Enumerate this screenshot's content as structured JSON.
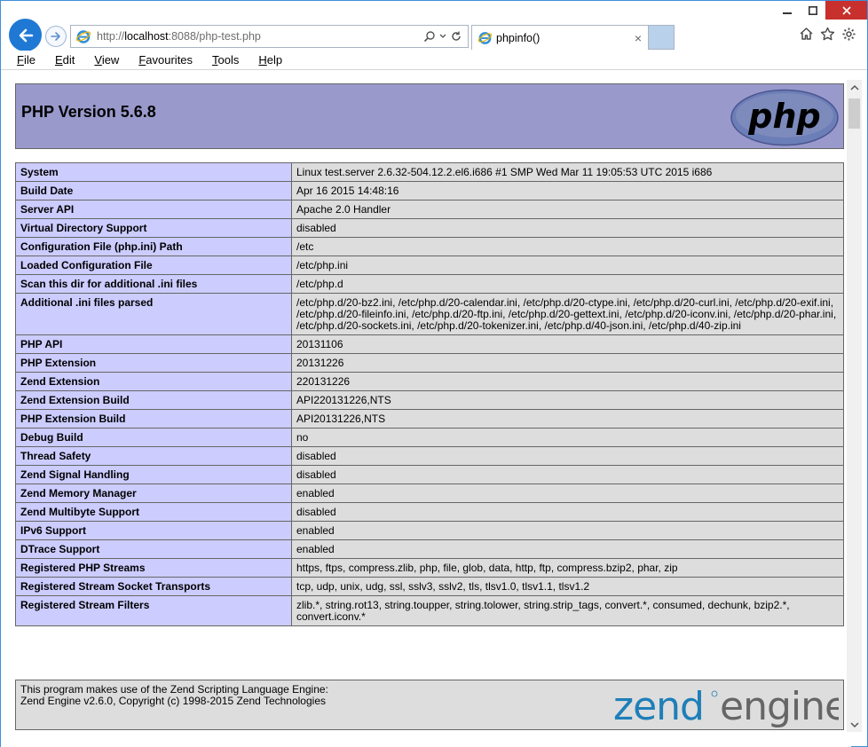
{
  "browser": {
    "address": {
      "proto": "http://",
      "host": "localhost",
      "rest": ":8088/php-test.php"
    },
    "tab_title": "phpinfo()",
    "menu": [
      {
        "label": "File",
        "key": "F",
        "rest": "ile"
      },
      {
        "label": "Edit",
        "key": "E",
        "rest": "dit"
      },
      {
        "label": "View",
        "key": "V",
        "rest": "iew"
      },
      {
        "label": "Favourites",
        "key": "F",
        "rest": "avourites"
      },
      {
        "label": "Tools",
        "key": "T",
        "rest": "ools"
      },
      {
        "label": "Help",
        "key": "H",
        "rest": "elp"
      }
    ],
    "accent_color": "#1f79d4",
    "close_color": "#c7302c"
  },
  "page": {
    "title": "PHP Version 5.6.8",
    "logo_text": "php",
    "rows": [
      {
        "key": "System",
        "value": "Linux test.server 2.6.32-504.12.2.el6.i686 #1 SMP Wed Mar 11 19:05:53 UTC 2015 i686"
      },
      {
        "key": "Build Date",
        "value": "Apr 16 2015 14:48:16"
      },
      {
        "key": "Server API",
        "value": "Apache 2.0 Handler"
      },
      {
        "key": "Virtual Directory Support",
        "value": "disabled"
      },
      {
        "key": "Configuration File (php.ini) Path",
        "value": "/etc"
      },
      {
        "key": "Loaded Configuration File",
        "value": "/etc/php.ini"
      },
      {
        "key": "Scan this dir for additional .ini files",
        "value": "/etc/php.d"
      },
      {
        "key": "Additional .ini files parsed",
        "value": "/etc/php.d/20-bz2.ini, /etc/php.d/20-calendar.ini, /etc/php.d/20-ctype.ini, /etc/php.d/20-curl.ini, /etc/php.d/20-exif.ini, /etc/php.d/20-fileinfo.ini, /etc/php.d/20-ftp.ini, /etc/php.d/20-gettext.ini, /etc/php.d/20-iconv.ini, /etc/php.d/20-phar.ini, /etc/php.d/20-sockets.ini, /etc/php.d/20-tokenizer.ini, /etc/php.d/40-json.ini, /etc/php.d/40-zip.ini"
      },
      {
        "key": "PHP API",
        "value": "20131106"
      },
      {
        "key": "PHP Extension",
        "value": "20131226"
      },
      {
        "key": "Zend Extension",
        "value": "220131226"
      },
      {
        "key": "Zend Extension Build",
        "value": "API220131226,NTS"
      },
      {
        "key": "PHP Extension Build",
        "value": "API20131226,NTS"
      },
      {
        "key": "Debug Build",
        "value": "no"
      },
      {
        "key": "Thread Safety",
        "value": "disabled"
      },
      {
        "key": "Zend Signal Handling",
        "value": "disabled"
      },
      {
        "key": "Zend Memory Manager",
        "value": "enabled"
      },
      {
        "key": "Zend Multibyte Support",
        "value": "disabled"
      },
      {
        "key": "IPv6 Support",
        "value": "enabled"
      },
      {
        "key": "DTrace Support",
        "value": "enabled"
      },
      {
        "key": "Registered PHP Streams",
        "value": "https, ftps, compress.zlib, php, file, glob, data, http, ftp, compress.bzip2, phar, zip"
      },
      {
        "key": "Registered Stream Socket Transports",
        "value": "tcp, udp, unix, udg, ssl, sslv3, sslv2, tls, tlsv1.0, tlsv1.1, tlsv1.2"
      },
      {
        "key": "Registered Stream Filters",
        "value": "zlib.*, string.rot13, string.toupper, string.tolower, string.strip_tags, convert.*, consumed, dechunk, bzip2.*, convert.iconv.*"
      }
    ],
    "zend": {
      "line1": "This program makes use of the Zend Scripting Language Engine:",
      "line2": "Zend Engine v2.6.0, Copyright (c) 1998-2015 Zend Technologies",
      "logo_word1": "zend",
      "logo_word2": "engine"
    },
    "colors": {
      "header_bg": "#9999cc",
      "key_bg": "#ccccff",
      "value_bg": "#dddddd"
    }
  }
}
